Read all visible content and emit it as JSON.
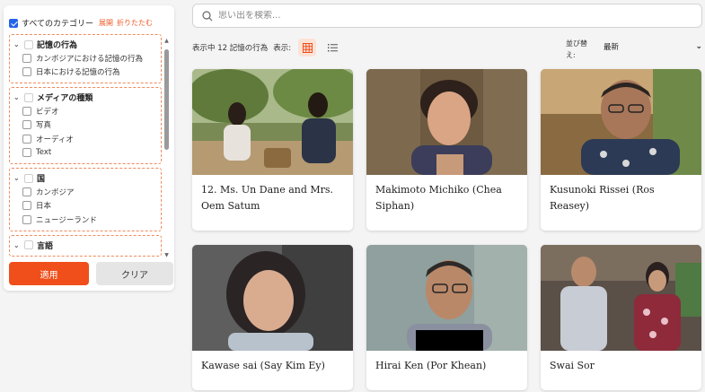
{
  "filters": {
    "all_label": "すべてのカテゴリー",
    "expand_label": "展開",
    "collapse_label": "折りたたむ",
    "groups": [
      {
        "label": "記憶の行為",
        "items": [
          "カンボジアにおける記憶の行為",
          "日本における記憶の行為"
        ]
      },
      {
        "label": "メディアの種類",
        "items": [
          "ビデオ",
          "写真",
          "オーディオ",
          "Text"
        ]
      },
      {
        "label": "国",
        "items": [
          "カンボジア",
          "日本",
          "ニュージーランド"
        ]
      },
      {
        "label": "言語",
        "items": []
      }
    ],
    "apply_label": "適用",
    "clear_label": "クリア"
  },
  "search": {
    "placeholder": "思い出を検索..."
  },
  "toolbar": {
    "count_text": "表示中 12 記憶の行為",
    "view_label": "表示:",
    "sort_label": "並び替え:",
    "sort_value": "最新"
  },
  "cards": [
    {
      "title": "12. Ms. Un Dane and Mrs. Oem Satum"
    },
    {
      "title": "Makimoto Michiko (Chea Siphan)"
    },
    {
      "title": "Kusunoki Rissei (Ros Reasey)"
    },
    {
      "title": "Kawase sai (Say Kim Ey)"
    },
    {
      "title": "Hirai Ken (Por Khean)"
    },
    {
      "title": "Swai Sor"
    }
  ],
  "colors": {
    "accent": "#f04e1a",
    "checkbox": "#2563eb",
    "group_border": "#f08a5d"
  }
}
